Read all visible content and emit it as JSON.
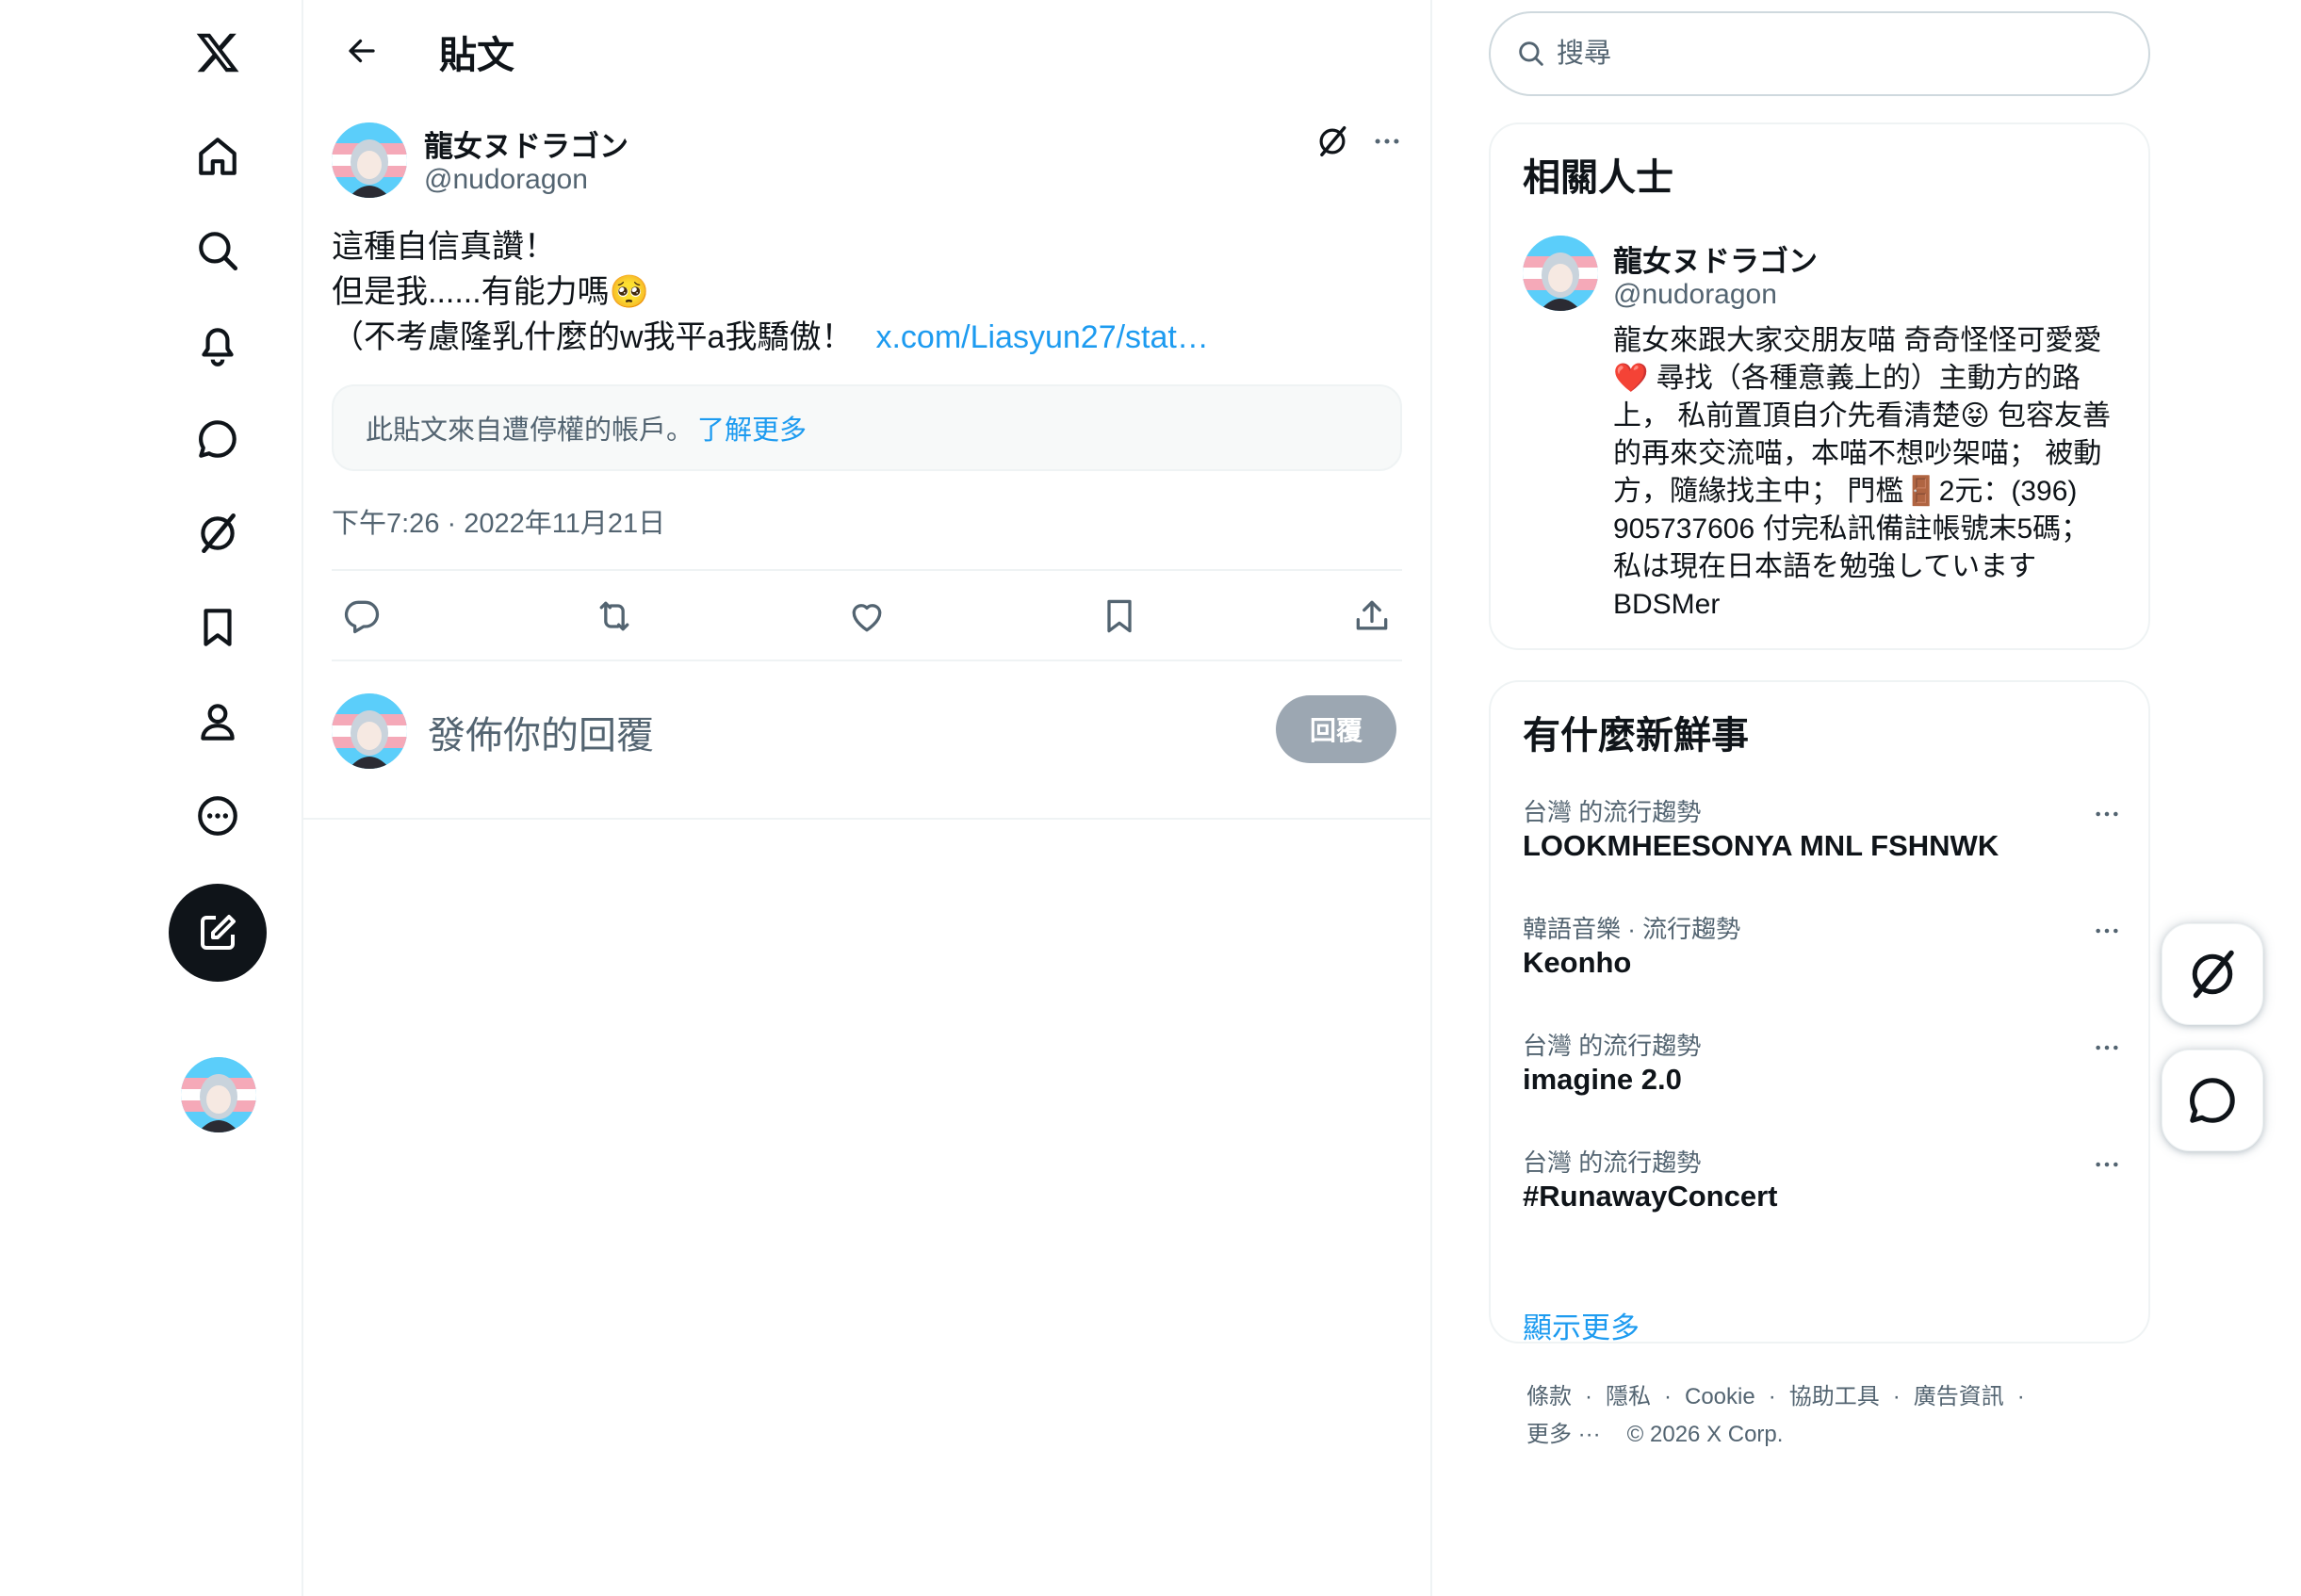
{
  "nav": {
    "items": [
      "home",
      "explore",
      "notifications",
      "messages",
      "grok",
      "bookmarks",
      "profile",
      "more"
    ]
  },
  "header": {
    "title": "貼文"
  },
  "tweet": {
    "author_name": "龍女ヌドラゴン",
    "author_handle": "@nudoragon",
    "lines": [
      "這種自信真讚！",
      "但是我......有能力嗎🥺",
      "（不考慮隆乳什麼的w我平a我驕傲！"
    ],
    "link": "x.com/Liasyun27/stat…",
    "notice": "此貼文來自遭停權的帳戶。",
    "notice_link": "了解更多",
    "timestamp": "下午7:26 · 2022年11月21日"
  },
  "reply": {
    "placeholder": "發佈你的回覆",
    "button": "回覆"
  },
  "search": {
    "placeholder": "搜尋"
  },
  "related": {
    "title": "相關人士",
    "name": "龍女ヌドラゴン",
    "handle": "@nudoragon",
    "bio": "龍女來跟大家交朋友喵 奇奇怪怪可愛愛\n❤️ 尋找（各種意義上的）主動方的路\n上， 私前置頂自介先看清楚😝 包容友善\n的再來交流喵，本喵不想吵架喵； 被動\n方，隨緣找主中； 門檻🚪2元：(396)\n905737606 付完私訊備註帳號末5碼；\n私は現在日本語を勉強しています\nBDSMer"
  },
  "trends": {
    "title": "有什麼新鮮事",
    "items": [
      {
        "meta": "台灣 的流行趨勢",
        "name": "LOOKMHEESONYA MNL FSHNWK"
      },
      {
        "meta": "韓語音樂 · 流行趨勢",
        "name": "Keonho"
      },
      {
        "meta": "台灣 的流行趨勢",
        "name": "imagine 2.0"
      },
      {
        "meta": "台灣 的流行趨勢",
        "name": "#RunawayConcert"
      }
    ],
    "show_more": "顯示更多"
  },
  "footer": {
    "links": [
      "條款",
      "隱私",
      "Cookie",
      "協助工具",
      "廣告資訊"
    ],
    "more": "更多 ···",
    "copyright": "© 2026 X Corp."
  },
  "colors": {
    "accent": "#1d9bf0",
    "text": "#0f1419",
    "muted": "#536471",
    "border": "#eff3f4"
  }
}
